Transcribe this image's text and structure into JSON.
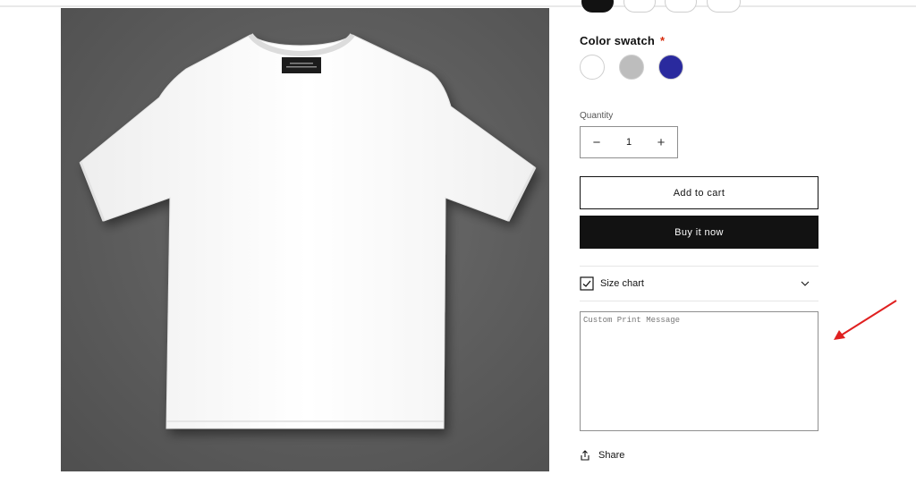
{
  "product": {
    "image_alt": "White crew-neck t-shirt mockup on grey background"
  },
  "color_swatch": {
    "label": "Color swatch",
    "required_marker": "*",
    "options": [
      {
        "name": "White",
        "color": "#ffffff"
      },
      {
        "name": "Grey",
        "color": "#bdbdbd"
      },
      {
        "name": "Blue",
        "color": "#2a2a9e"
      }
    ]
  },
  "quantity": {
    "label": "Quantity",
    "value": "1",
    "decrease_symbol": "−",
    "increase_symbol": "+"
  },
  "buttons": {
    "add_to_cart": "Add to cart",
    "buy_now": "Buy it now"
  },
  "size_chart": {
    "label": "Size chart"
  },
  "custom_print": {
    "placeholder": "Custom Print Message"
  },
  "share": {
    "label": "Share"
  },
  "colors": {
    "primary_dark": "#121212",
    "annotation_red": "#e02020",
    "image_bg": "#5f5f5f"
  }
}
